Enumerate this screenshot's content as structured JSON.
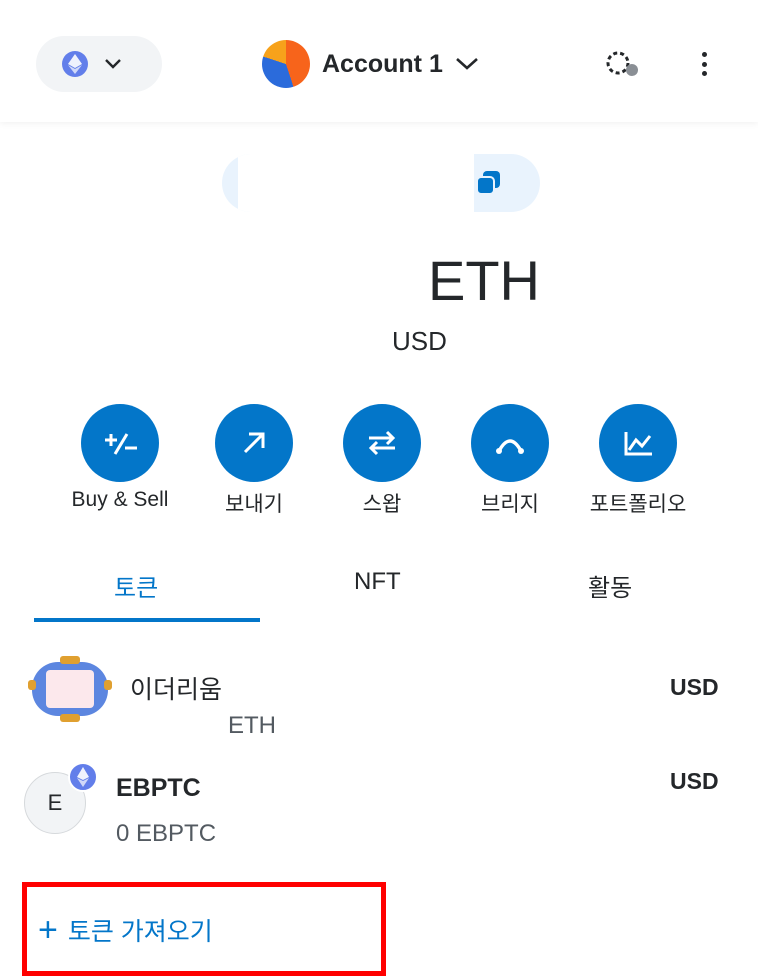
{
  "header": {
    "account_name": "Account 1"
  },
  "balance": {
    "token": "ETH",
    "fiat": "USD"
  },
  "actions": [
    {
      "label": "Buy & Sell",
      "icon": "buy-sell-icon"
    },
    {
      "label": "보내기",
      "icon": "send-arrow-icon"
    },
    {
      "label": "스왑",
      "icon": "swap-icon"
    },
    {
      "label": "브리지",
      "icon": "bridge-icon"
    },
    {
      "label": "포트폴리오",
      "icon": "portfolio-chart-icon"
    }
  ],
  "tabs": [
    {
      "label": "토큰",
      "active": true
    },
    {
      "label": "NFT",
      "active": false
    },
    {
      "label": "활동",
      "active": false
    }
  ],
  "tokens": [
    {
      "name": "이더리움",
      "amount": "ETH",
      "fiat": "USD",
      "icon": "ethereum-token-icon"
    },
    {
      "name": "EBPTC",
      "amount": "0 EBPTC",
      "fiat": "USD",
      "icon_letter": "E"
    }
  ],
  "import_tokens": {
    "label": "토큰 가져오기"
  },
  "colors": {
    "accent": "#0376c9",
    "highlight_box": "#ff0000",
    "network_pill": "#f2f4f6",
    "address_pill": "#e9f3fd"
  }
}
